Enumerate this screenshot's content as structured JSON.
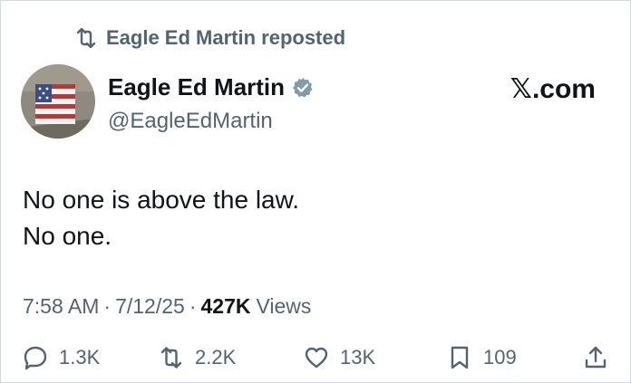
{
  "repost": {
    "label": "Eagle Ed Martin reposted"
  },
  "author": {
    "display_name": "Eagle Ed Martin",
    "handle": "@EagleEdMartin",
    "verified": true
  },
  "watermark": "𝕏.com",
  "tweet": {
    "lines": [
      "No one is above the law.",
      "No one."
    ]
  },
  "meta": {
    "time": "7:58 AM",
    "date": "7/12/25",
    "views_count": "427K",
    "views_label": "Views"
  },
  "actions": {
    "replies": "1.3K",
    "reposts": "2.2K",
    "likes": "13K",
    "bookmarks": "109"
  },
  "colors": {
    "text_primary": "#0f1419",
    "text_secondary": "#536471",
    "verified_badge": "#829aab",
    "border": "#cfd9de"
  }
}
